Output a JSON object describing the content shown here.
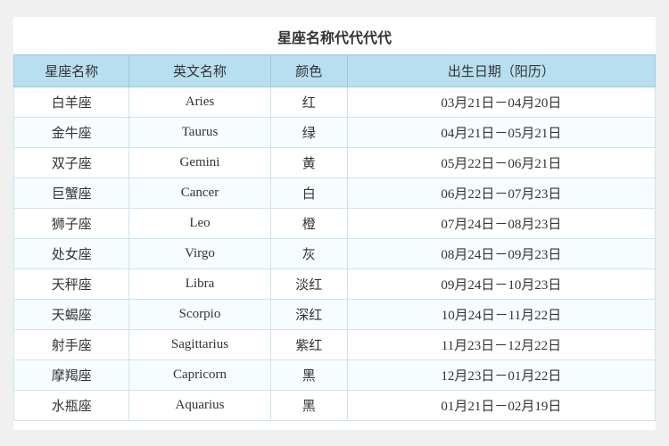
{
  "title": "星座名称代代代代",
  "headers": {
    "col1": "星座名称",
    "col2": "英文名称",
    "col3": "颜色",
    "col4": "出生日期（阳历）"
  },
  "rows": [
    {
      "zh": "白羊座",
      "en": "Aries",
      "color": "红",
      "date": "03月21日－04月20日"
    },
    {
      "zh": "金牛座",
      "en": "Taurus",
      "color": "绿",
      "date": "04月21日－05月21日"
    },
    {
      "zh": "双子座",
      "en": "Gemini",
      "color": "黄",
      "date": "05月22日－06月21日"
    },
    {
      "zh": "巨蟹座",
      "en": "Cancer",
      "color": "白",
      "date": "06月22日－07月23日"
    },
    {
      "zh": "狮子座",
      "en": "Leo",
      "color": "橙",
      "date": "07月24日－08月23日"
    },
    {
      "zh": "处女座",
      "en": "Virgo",
      "color": "灰",
      "date": "08月24日－09月23日"
    },
    {
      "zh": "天秤座",
      "en": "Libra",
      "color": "淡红",
      "date": "09月24日－10月23日"
    },
    {
      "zh": "天蝎座",
      "en": "Scorpio",
      "color": "深红",
      "date": "10月24日－11月22日"
    },
    {
      "zh": "射手座",
      "en": "Sagittarius",
      "color": "紫红",
      "date": "11月23日－12月22日"
    },
    {
      "zh": "摩羯座",
      "en": "Capricorn",
      "color": "黑",
      "date": "12月23日－01月22日"
    },
    {
      "zh": "水瓶座",
      "en": "Aquarius",
      "color": "黑",
      "date": "01月21日－02月19日"
    }
  ]
}
